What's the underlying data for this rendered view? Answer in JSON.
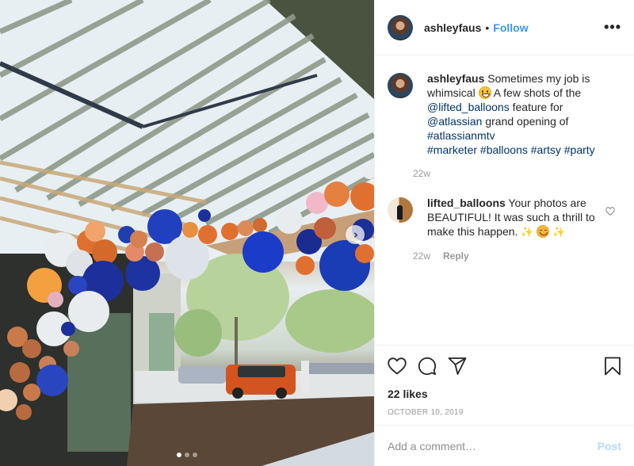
{
  "post": {
    "photo_alt": "Balloon arch of blue, white, orange and pink balloons under a slatted wooden canopy outside a building entrance, with trees and parked cars in the background",
    "carousel": {
      "current_index": 1,
      "total": 3,
      "next_icon": "chevron-right-icon"
    },
    "colors": {
      "follow": "#3897f0",
      "link": "#003569",
      "muted": "#999999",
      "post_disabled": "#b3dbff",
      "text": "#262626"
    }
  },
  "header": {
    "username": "ashleyfaus",
    "separator": "•",
    "follow_label": "Follow",
    "more_icon": "•••"
  },
  "caption": {
    "username": "ashleyfaus",
    "text_1": " Sometimes my job is whimsical ",
    "emoji_1": "grinning-face",
    "text_2": " A few shots of the ",
    "mention_1": "@lifted_balloons",
    "text_3": " feature for ",
    "mention_2": "@atlassian",
    "text_4": " grand opening of ",
    "hashtag_1": "#atlassianmtv",
    "hashtag_2": "#marketer",
    "hashtag_3": "#balloons",
    "hashtag_4": "#artsy",
    "hashtag_5": "#party",
    "age": "22w"
  },
  "comments": [
    {
      "username": "lifted_balloons",
      "text": " Your photos are BEAUTIFUL! It was such a thrill to make this happen. ",
      "emojis": [
        "sparkles",
        "smiling-face-with-smiling-eyes",
        "sparkles"
      ],
      "sparkle": "✨",
      "age": "22w",
      "reply_label": "Reply"
    }
  ],
  "actions": {
    "like_icon": "heart-icon",
    "comment_icon": "comment-icon",
    "share_icon": "share-icon",
    "save_icon": "bookmark-icon",
    "likes_text": "22 likes",
    "date": "OCTOBER 10, 2019"
  },
  "add_comment": {
    "placeholder": "Add a comment…",
    "value": "",
    "post_label": "Post"
  }
}
